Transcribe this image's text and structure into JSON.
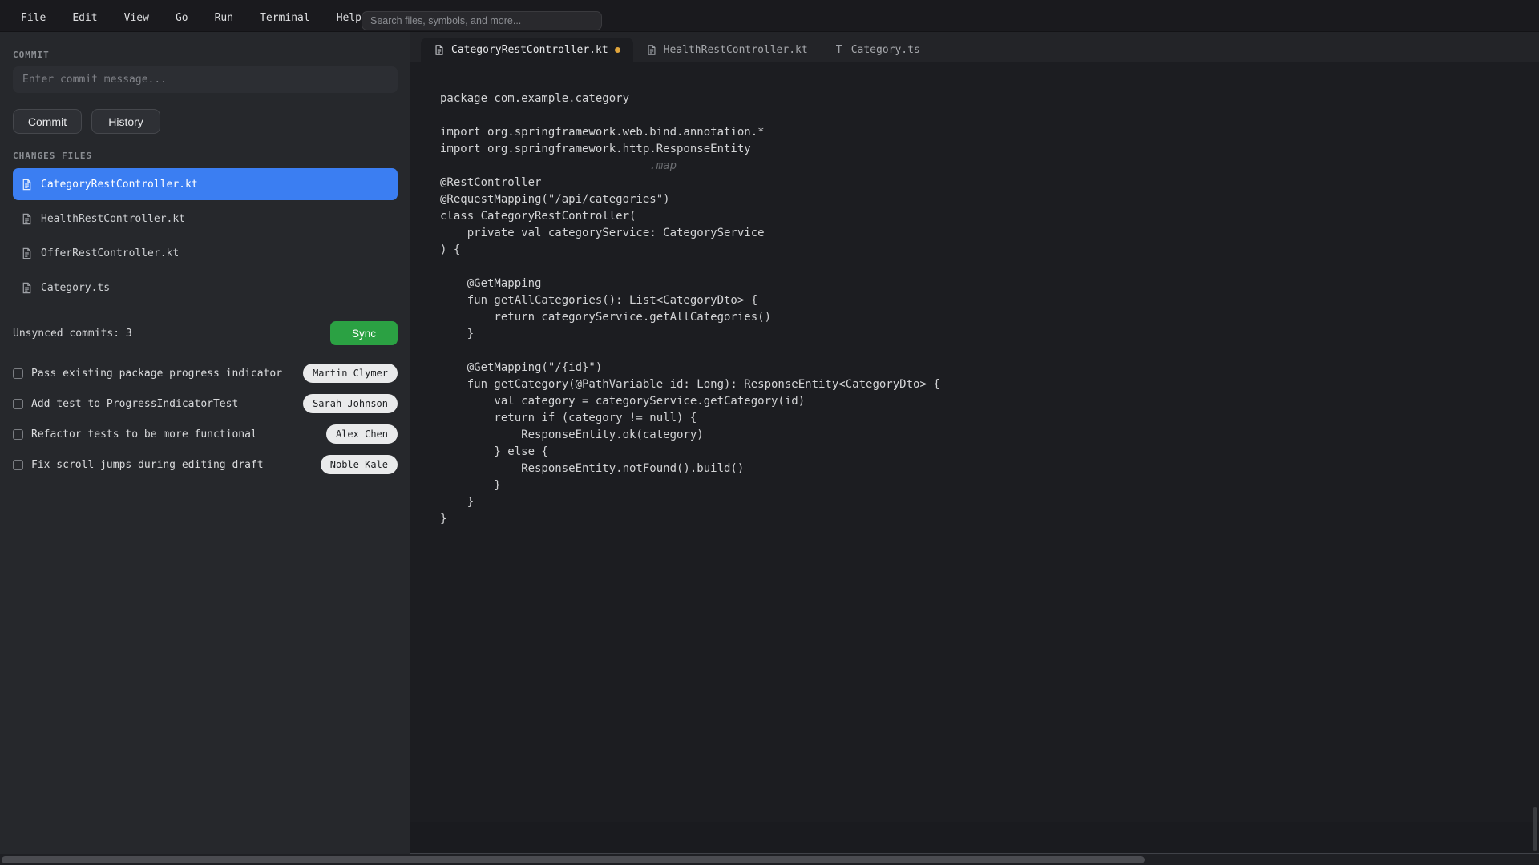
{
  "colors": {
    "accent_blue": "#3b7ef2",
    "sync_green": "#2ba143",
    "modified_dot": "#e0a53c",
    "pill_bg": "#e9eaeb",
    "pill_text": "#1e2023"
  },
  "menubar": {
    "items": [
      "File",
      "Edit",
      "View",
      "Go",
      "Run",
      "Terminal",
      "Help"
    ],
    "search_placeholder": "Search files, symbols, and more..."
  },
  "sidebar": {
    "commit": {
      "title": "COMMIT",
      "message_placeholder": "Enter commit message...",
      "commit_label": "Commit",
      "history_label": "History"
    },
    "changes": {
      "title": "CHANGES FILES",
      "files": [
        {
          "name": "CategoryRestController.kt",
          "selected": true
        },
        {
          "name": "HealthRestController.kt",
          "selected": false
        },
        {
          "name": "OfferRestController.kt",
          "selected": false
        },
        {
          "name": "Category.ts",
          "selected": false
        }
      ]
    },
    "sync": {
      "status": "Unsynced commits: 3",
      "button_label": "Sync"
    },
    "tasks": [
      {
        "label": "Pass existing package progress indicator",
        "assignee": "Martin Clymer",
        "checked": false
      },
      {
        "label": "Add test to ProgressIndicatorTest",
        "assignee": "Sarah Johnson",
        "checked": false
      },
      {
        "label": "Refactor tests to be more functional",
        "assignee": "Alex Chen",
        "checked": false
      },
      {
        "label": "Fix scroll jumps during editing draft",
        "assignee": "Noble Kale",
        "checked": false
      }
    ]
  },
  "editor": {
    "tabs": [
      {
        "label": "CategoryRestController.kt",
        "icon": "file",
        "modified": true,
        "active": true
      },
      {
        "label": "HealthRestController.kt",
        "icon": "file",
        "modified": false,
        "active": false
      },
      {
        "label": "Category.ts",
        "icon": "typescript",
        "modified": false,
        "active": false
      }
    ],
    "ghost_suggestion": {
      "line": 4,
      "column": 31,
      "text": ".map"
    },
    "code_lines": [
      "package com.example.category",
      "",
      "import org.springframework.web.bind.annotation.*",
      "import org.springframework.http.ResponseEntity",
      "",
      "@RestController",
      "@RequestMapping(\"/api/categories\")",
      "class CategoryRestController(",
      "    private val categoryService: CategoryService",
      ") {",
      "",
      "    @GetMapping",
      "    fun getAllCategories(): List<CategoryDto> {",
      "        return categoryService.getAllCategories()",
      "    }",
      "",
      "    @GetMapping(\"/{id}\")",
      "    fun getCategory(@PathVariable id: Long): ResponseEntity<CategoryDto> {",
      "        val category = categoryService.getCategory(id)",
      "        return if (category != null) {",
      "            ResponseEntity.ok(category)",
      "        } else {",
      "            ResponseEntity.notFound().build()",
      "        }",
      "    }",
      "}"
    ]
  }
}
